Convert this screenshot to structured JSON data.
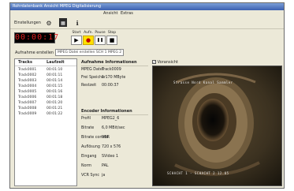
{
  "window": {
    "title": "Rohrdatenbank Ansicht MPEG Digitalisierung"
  },
  "menu": {
    "items": [
      "Ansicht",
      "Extras"
    ]
  },
  "toolbar": {
    "einstellungen_label": "Einstellungen",
    "ctl_labels": [
      "Start",
      "Aufn.",
      "Pause",
      "Stop"
    ],
    "ctl_glyphs": [
      "▶",
      "●",
      "❚❚",
      "■"
    ]
  },
  "timer": {
    "value": "00:00:17"
  },
  "recording": {
    "label": "Aufnahme erstellen",
    "value": "MPEG Datei erstellen SCH 1 MPEG 2"
  },
  "tracks": {
    "headers": [
      "Tracks",
      "Laufzeit"
    ],
    "rows": [
      [
        "Track0001",
        "00:01:10"
      ],
      [
        "Track0002",
        "00:01:11"
      ],
      [
        "Track0003",
        "00:01:14"
      ],
      [
        "Track0004",
        "00:01:15"
      ],
      [
        "Track0005",
        "00:01:16"
      ],
      [
        "Track0006",
        "00:01:18"
      ],
      [
        "Track0007",
        "00:01:20"
      ],
      [
        "Track0008",
        "00:01:21"
      ],
      [
        "Track0009",
        "00:01:22"
      ]
    ]
  },
  "info": {
    "aufnahme_title": "Aufnahme Informationen",
    "aufnahme": [
      [
        "MPEG Datei",
        "Track0009"
      ],
      [
        "Frei Speicher",
        "1.170 MByte"
      ],
      [
        "Restzeit",
        "00:00:37"
      ]
    ],
    "encoder_title": "Encoder Informationen",
    "encoder": [
      [
        "Profil",
        "MPEG2_6"
      ],
      [
        "Bitrate",
        "6,0 MBit/sec"
      ],
      [
        "Bitrate control",
        "VBR"
      ],
      [
        "Auflösung",
        "720 x 576"
      ],
      [
        "Eingang",
        "SVideo 1"
      ],
      [
        "Norm",
        "PAL"
      ],
      [
        "VCR Sync",
        "ja"
      ]
    ]
  },
  "preview": {
    "label": "Voransicht",
    "checkbox_checked": true,
    "overlay_top": "Strasse Nord Kanal Sammler",
    "overlay_bottom": "SCHACHT 1 - SCHACHT 2  12.05"
  },
  "colors": {
    "titlebar": "#3b5fb0",
    "timer_digits": "#e02020",
    "active_button": "#ffe000"
  }
}
